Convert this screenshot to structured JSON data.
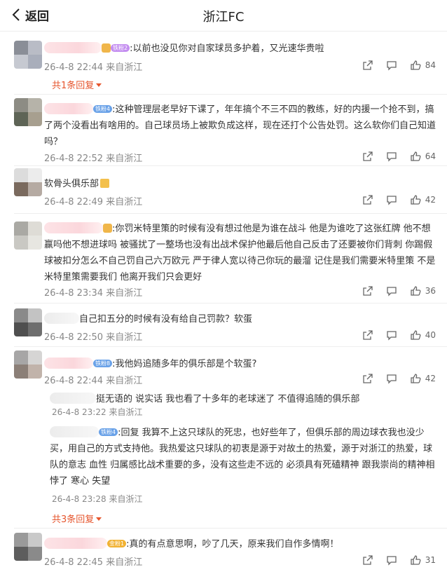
{
  "header": {
    "back_label": "返回",
    "title": "浙江FC"
  },
  "comments": [
    {
      "text": ":以前也没见你对自家球员多护着，又光速华贵啦",
      "badge": "铁粉2",
      "time": "26-4-8 22:44",
      "location": "来自浙江",
      "likes": "84",
      "more_replies": "共1条回复"
    },
    {
      "text": ":这种管理层老早好下课了，年年搞个不三不四的教练，好的内援一个抢不到，搞了两个没看出有啥用的。自己球员场上被欺负成这样，现在还打个公告处罚。这么软你们自己知道吗？",
      "badge": "铁粉4",
      "time": "26-4-8 22:52",
      "location": "来自浙江",
      "likes": "64"
    },
    {
      "text": "软骨头俱乐部",
      "time": "26-4-8 22:49",
      "location": "来自浙江",
      "likes": "42"
    },
    {
      "text": ":你罚米特里策的时候有没有想过他是为谁在战斗 他是为谁吃了这张红牌 他不想赢吗他不想进球吗 被骚扰了一整场也没有出战术保护他最后他自己反击了还要被你们背刺 你踢假球被扣分怎么不自己罚自己六万欧元 严于律人宽以待己你玩的最溜 记住是我们需要米特里策 不是米特里策需要我们 他离开我们只会更好",
      "time": "26-4-8 23:34",
      "location": "来自浙江",
      "likes": "36"
    },
    {
      "text": "自己扣五分的时候有没有给自己罚款？软蛋",
      "time": "26-4-8 22:50",
      "location": "来自浙江",
      "likes": "40"
    },
    {
      "text": ":我他妈追随多年的俱乐部是个软蛋?",
      "badge": "铁粉8",
      "time": "26-4-8 22:44",
      "location": "来自浙江",
      "likes": "42",
      "replies": [
        {
          "text": "挺无语的 说实话 我也看了十多年的老球迷了 不值得追随的俱乐部",
          "time": "26-4-8 23:22",
          "location": "来自浙江"
        },
        {
          "text": ":回复 我算不上这只球队的死忠，也好些年了，但俱乐部的周边球衣我也没少买，用自己的方式支持他。我热爱这只球队的初衷是源于对故土的热爱，源于对浙江的热爱，球队的意志 血性 归属感比战术重要的多，没有这些走不远的 必须具有死磕精神 跟我崇尚的精神相悖了 寒心 失望",
          "badge": "铁粉4",
          "time": "26-4-8 23:28",
          "location": "来自浙江"
        }
      ],
      "more_replies": "共3条回复"
    },
    {
      "text": ":真的有点意思啊，吵了几天，原来我们自作多情啊！",
      "badge": "金粉1",
      "time": "26-4-8 22:45",
      "location": "来自浙江",
      "likes": "31"
    }
  ],
  "icons": {
    "back": "chevron-left-icon",
    "share": "share-icon",
    "reply": "comment-icon",
    "like": "thumbs-up-icon"
  },
  "colors": {
    "accent": "#e6552d",
    "meta": "#888888",
    "badge_blue": "#6aa2e8"
  }
}
